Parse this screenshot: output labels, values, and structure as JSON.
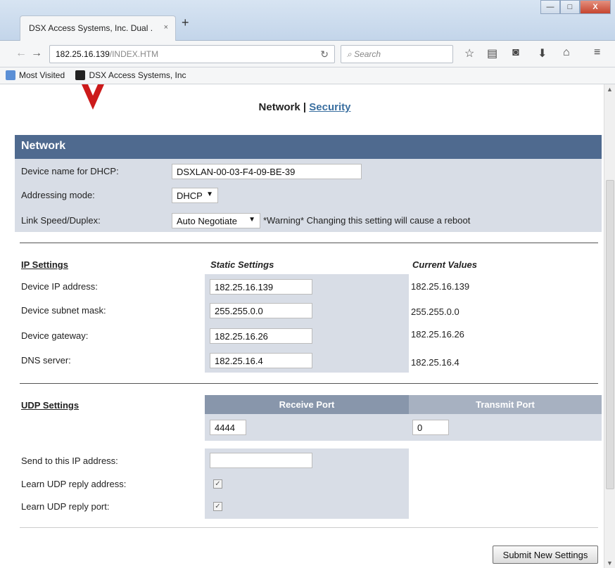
{
  "browser": {
    "tab_title": "DSX Access Systems, Inc. Dual ...",
    "tab_close": "×",
    "new_tab": "+",
    "url_host": "182.25.16.139",
    "url_path": "/INDEX.HTM",
    "search_placeholder": "Search",
    "bookmarks": [
      {
        "label": "Most Visited"
      },
      {
        "label": "DSX Access Systems, Inc"
      }
    ],
    "window_buttons": {
      "minimize": "—",
      "maximize": "□",
      "close": "X"
    }
  },
  "page": {
    "nav": {
      "network": "Network",
      "separator": " | ",
      "security": "Security"
    },
    "network": {
      "heading": "Network",
      "device_name_label": "Device name for DHCP:",
      "device_name_value": "DSXLAN-00-03-F4-09-BE-39",
      "addressing_label": "Addressing mode:",
      "addressing_value": "DHCP",
      "link_label": "Link Speed/Duplex:",
      "link_value": "Auto Negotiate",
      "link_warning": "*Warning* Changing this setting will cause a reboot"
    },
    "ip": {
      "heading": "IP Settings",
      "static_heading": "Static Settings",
      "current_heading": "Current Values",
      "rows": [
        {
          "label": "Device IP address:",
          "static": "182.25.16.139",
          "current": "182.25.16.139"
        },
        {
          "label": "Device subnet mask:",
          "static": "255.255.0.0",
          "current": "255.255.0.0"
        },
        {
          "label": "Device gateway:",
          "static": "182.25.16.26",
          "current": "182.25.16.26"
        },
        {
          "label": "DNS server:",
          "static": "182.25.16.4",
          "current": "182.25.16.4"
        }
      ]
    },
    "udp": {
      "heading": "UDP Settings",
      "receive_heading": "Receive Port",
      "transmit_heading": "Transmit Port",
      "receive_port": "4444",
      "transmit_port": "0",
      "send_to_label": "Send to this IP address:",
      "send_to_value": "",
      "learn_address_label": "Learn UDP reply address:",
      "learn_address_checked": true,
      "learn_port_label": "Learn UDP reply port:",
      "learn_port_checked": true
    },
    "submit_label": "Submit New Settings"
  },
  "colors": {
    "section_header": "#4f6a8f",
    "panel": "#d8dde6",
    "logo": "#cc1a1a",
    "link": "#3a6fa0"
  },
  "icons": [
    "back-icon",
    "forward-icon",
    "reload-icon",
    "search-icon",
    "bookmark-star-icon",
    "reading-list-icon",
    "pocket-icon",
    "download-icon",
    "home-icon",
    "menu-icon"
  ]
}
